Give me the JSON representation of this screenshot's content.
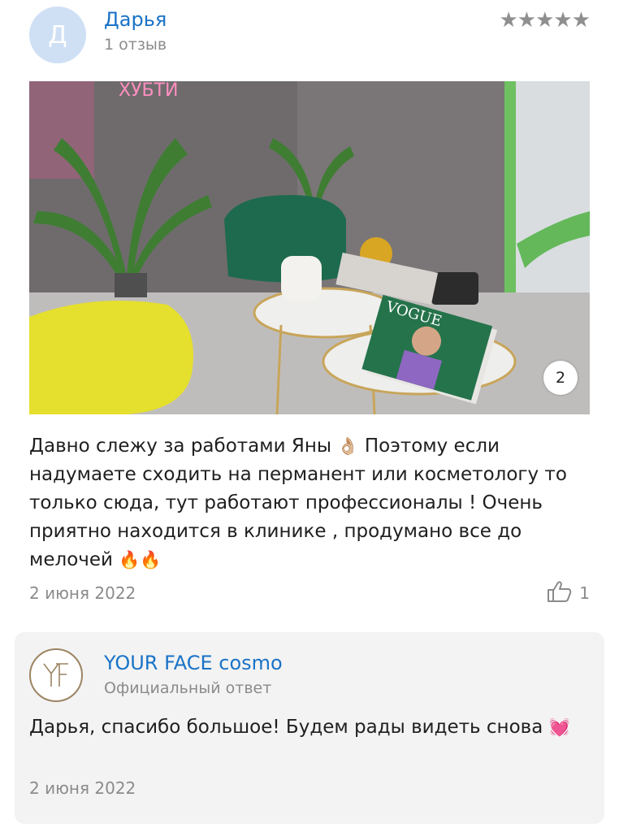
{
  "review": {
    "author_initial": "Д",
    "author_name": "Дарья",
    "review_count": "1 отзыв",
    "stars": "★★★★★",
    "photo_count": "2",
    "text_main": "Давно слежу за работами Яны",
    "text_continue": " Поэтому если надумаете сходить на перманент или косметологу то только сюда, тут работают профессионалы ! Очень приятно находится в клинике , продумано все до мелочей",
    "emoji_ok": "👌🏼",
    "emoji_fire": "🔥🔥",
    "date": "2 июня 2022",
    "likes": "1"
  },
  "reply": {
    "company_name": "YOUR FACE cosmo",
    "official_label": "Официальный ответ",
    "text": "Дарья, спасибо большое! Будем рады видеть снова",
    "emoji_heart": "💓",
    "date": "2 июня 2022"
  },
  "colors": {
    "link": "#1a73c7",
    "muted": "#8b8b8b",
    "star": "#8f8f8f",
    "card": "#f3f3f3"
  }
}
